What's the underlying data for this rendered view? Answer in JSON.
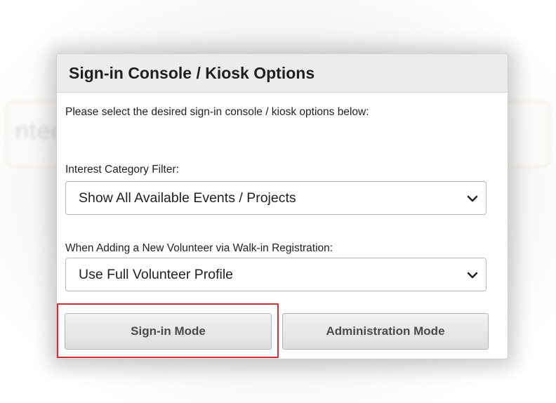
{
  "background": {
    "text": "ntee"
  },
  "dialog": {
    "title": "Sign-in Console / Kiosk Options",
    "intro": "Please select the desired sign-in console / kiosk options below:",
    "interest_filter": {
      "label": "Interest Category Filter:",
      "selected": "Show All Available Events / Projects"
    },
    "walkin": {
      "label": "When Adding a New Volunteer via Walk-in Registration:",
      "selected": "Use Full Volunteer Profile"
    },
    "buttons": {
      "signin": "Sign-in Mode",
      "admin": "Administration Mode"
    }
  },
  "annotation": {
    "highlight_color": "#e8262c"
  },
  "icons": {
    "dropdown": "chevron-down-icon"
  }
}
